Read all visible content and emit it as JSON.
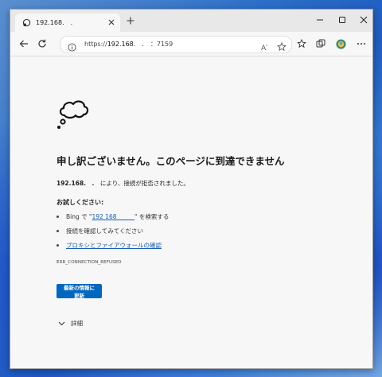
{
  "tab": {
    "title": "192.168.　."
  },
  "address": {
    "prefix": "https://",
    "host": "192.168.　.　",
    "port": "：7159"
  },
  "error": {
    "title": "申し訳ございません。このページに到達できません",
    "host": "192.168.　.",
    "description": "　により、接続が拒否されました。",
    "try_heading": "お試しください:",
    "suggestion_1_prefix": "Bing で \"",
    "suggestion_1_link": "192 168　　　",
    "suggestion_1_suffix": "\" を検索する",
    "suggestion_2": "接続を確認してみてください",
    "suggestion_3_link": "プロキシとファイアウォールの確認",
    "code": "ERR_CONNECTION_REFUSED",
    "refresh_label": "最新の情報に更新",
    "details_label": "詳細"
  }
}
